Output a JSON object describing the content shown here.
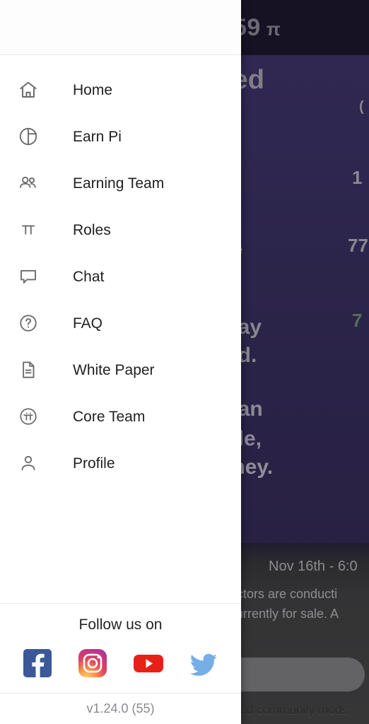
{
  "drawer": {
    "nav_items": [
      {
        "label": "Home",
        "icon": "home-icon"
      },
      {
        "label": "Earn Pi",
        "icon": "pie-chart-icon"
      },
      {
        "label": "Earning Team",
        "icon": "people-icon"
      },
      {
        "label": "Roles",
        "icon": "pi-symbol-icon"
      },
      {
        "label": "Chat",
        "icon": "chat-bubble-icon"
      },
      {
        "label": "FAQ",
        "icon": "question-circle-icon"
      },
      {
        "label": "White Paper",
        "icon": "document-icon"
      },
      {
        "label": "Core Team",
        "icon": "pi-network-logo-icon"
      },
      {
        "label": "Profile",
        "icon": "person-icon"
      }
    ],
    "social": {
      "follow_label": "Follow us on",
      "links": [
        {
          "name": "facebook",
          "color": "#3b5998"
        },
        {
          "name": "instagram",
          "color": "#e1306c"
        },
        {
          "name": "youtube",
          "color": "#e62117"
        },
        {
          "name": "twitter",
          "color": "#76aee6"
        }
      ]
    },
    "version": "v1.24.0 (55)"
  },
  "background": {
    "balance": "59",
    "pi_symbol": "π",
    "headline": "ized",
    "figures": [
      "(",
      "1",
      "77",
      "7"
    ],
    "small_text": "e",
    "lines": [
      "today",
      "ed.",
      "n an",
      "ale,",
      "oney."
    ],
    "event_date": "Nov 16th - 6:0",
    "news_line_1": "actors are conducti",
    "news_line_2": "currently for sale. A",
    "footnote": "and community mods."
  },
  "colors": {
    "drawer_bg": "#ffffff",
    "nav_text": "#212124",
    "nav_icon": "#6b6b6f",
    "divider": "#e9e9ec",
    "version_text": "#8b8b90",
    "hero_purple": "#3e3469",
    "statusbar": "#221a33"
  }
}
